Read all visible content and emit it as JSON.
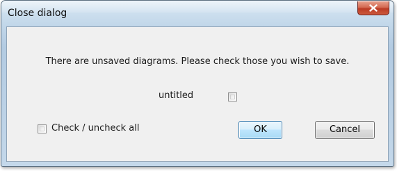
{
  "window": {
    "title": "Close dialog",
    "close_icon": "close-x-icon"
  },
  "dialog": {
    "message": "There are unsaved diagrams. Please check those you wish to save.",
    "diagrams": [
      {
        "name": "untitled",
        "checked": false
      }
    ],
    "check_all_label": "Check / uncheck all",
    "check_all_checked": false,
    "ok_label": "OK",
    "cancel_label": "Cancel"
  },
  "colors": {
    "title_bar": "#b9d1e7",
    "close_button": "#c9492f",
    "client_background": "#f0f0f0",
    "default_button_border": "#3c7fb1"
  }
}
